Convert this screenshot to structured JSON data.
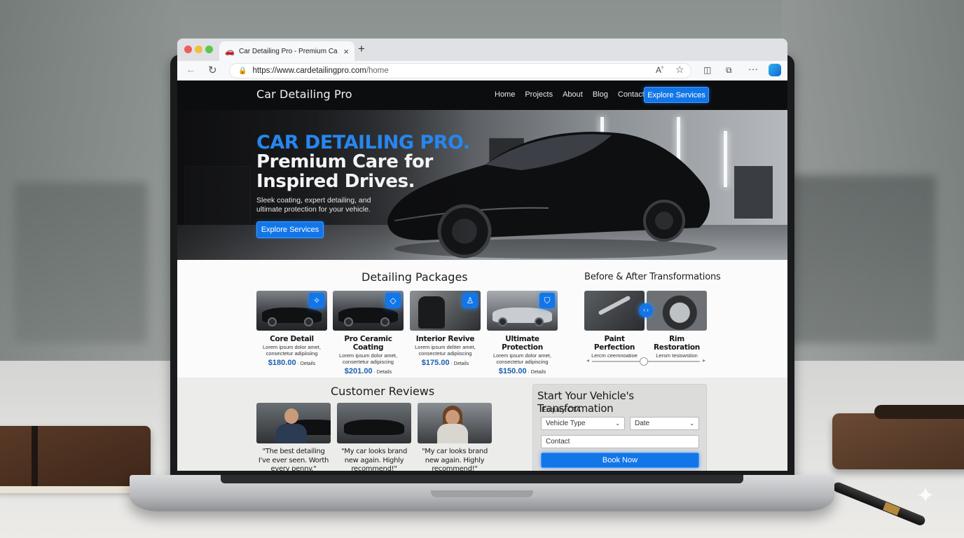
{
  "browser": {
    "tab_title": "Car Detailing Pro - Premium Ca",
    "tab_close": "×",
    "new_tab": "+",
    "url_base": "https://www.",
    "url_domain": "cardetailingpro.com",
    "url_path": "/home"
  },
  "icons": {
    "back": "back-arrow-icon",
    "reload": "reload-icon",
    "lock": "lock-icon",
    "read_aloud": "read-aloud-icon",
    "favorite": "star-icon",
    "split_screen": "split-screen-icon",
    "extensions": "extensions-icon",
    "more": "more-icon",
    "copilot": "copilot-icon"
  },
  "site": {
    "brand": "Car Detailing Pro",
    "nav": [
      "Home",
      "Projects",
      "About",
      "Blog",
      "Contact"
    ],
    "nav_cta": "Explore Services",
    "colors": {
      "accent": "#1276e8",
      "nav_bg": "#0c0d0e",
      "price": "#1a5fb0"
    }
  },
  "hero": {
    "title_accent": "CAR DETAILING PRO.",
    "title": "Premium Care for Inspired Drives.",
    "subtitle": "Sleek coating, expert detailing, and ultimate protection for your vehicle.",
    "cta": "Explore Services"
  },
  "packages": {
    "heading": "Detailing Packages",
    "details_label": "· Details",
    "items": [
      {
        "name": "Core Detail",
        "desc": "Lorem ipsum dolor amet, consectetur adipiisiing",
        "price": "$180.00",
        "icon": "sparkle-icon"
      },
      {
        "name": "Pro Ceramic Coating",
        "desc": "Lorem ipsum dolor amet, consertetur adipiscing",
        "price": "$201.00",
        "icon": "diamond-icon"
      },
      {
        "name": "Interior Revive",
        "desc": "Lorem ipsum deliter amet, consectetur adipiiscing",
        "price": "$175.00",
        "icon": "seat-icon"
      },
      {
        "name": "Ultimate Protection",
        "desc": "Lorem ipsum dolor amet, consectetur adipiscing",
        "price": "$150.00",
        "icon": "shield-icon"
      }
    ]
  },
  "before_after": {
    "heading": "Before & After Transformations",
    "items": [
      {
        "name": "Paint Perfection",
        "desc": "Lercm ceemnoatioe"
      },
      {
        "name": "Rim Restoration",
        "desc": "Lersm tesiswstion"
      }
    ],
    "handle_label": "‹ ›"
  },
  "reviews": {
    "heading": "Customer Reviews",
    "items": [
      {
        "quote": "\"The best detailing I've ever seen. Worth every penny.\""
      },
      {
        "quote": "\"My car looks brand new again. Highly recommend!\""
      },
      {
        "quote": "\"My car looks brand new again. Highly recommend!\""
      }
    ]
  },
  "enquiry": {
    "title": "Start Your Vehicle's Transformation",
    "subtitle": "Enquiry CTA",
    "vehicle_type": "Vehicle Type",
    "date": "Date",
    "contact": "Contact",
    "submit": "Book Now"
  }
}
